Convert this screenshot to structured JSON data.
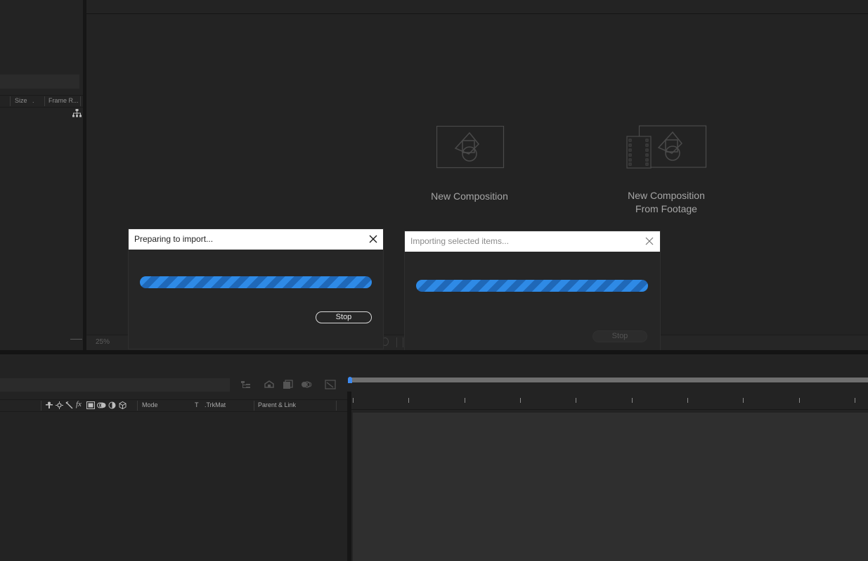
{
  "project_panel": {
    "columns": [
      {
        "label": "Size"
      },
      {
        "label": "."
      },
      {
        "label": "Frame R..."
      }
    ]
  },
  "viewer": {
    "zoom": "25%",
    "start_tiles": [
      {
        "label": "New Composition"
      },
      {
        "label_line1": "New Composition",
        "label_line2": "From Footage"
      }
    ]
  },
  "dialogs": [
    {
      "title": "Preparing to import...",
      "active": true,
      "progress": 1.0,
      "stop_label": "Stop",
      "stop_enabled": true
    },
    {
      "title": "Importing selected items...",
      "active": false,
      "progress": 1.0,
      "stop_label": "Stop",
      "stop_enabled": false
    }
  ],
  "timeline": {
    "switch_icons": [
      "shy-icon",
      "solo-icon",
      "lock-icon",
      "fx-icon",
      "frame-blend-icon",
      "motion-blur-icon",
      "adjustment-layer-icon",
      "3d-layer-icon"
    ],
    "columns": {
      "fx_glyph": "fx",
      "mode": "Mode",
      "t": "T",
      "trkmat": ".TrkMat",
      "parent": "Parent & Link"
    },
    "toolbar_icons": [
      "comp-flowchart-icon",
      "draft-3d-icon",
      "hide-shy-icon",
      "frame-blending-icon",
      "motion-blur-toggle-icon",
      "graph-editor-icon"
    ]
  },
  "colors": {
    "panel_bg": "#232323",
    "accent_blue": "#2e8ae6",
    "playhead": "#3d8af0",
    "dialog_title_bg": "#ffffff"
  }
}
